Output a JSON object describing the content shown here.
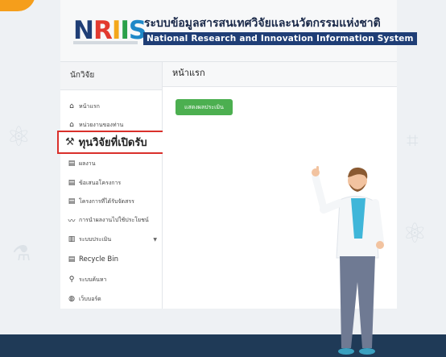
{
  "header": {
    "logo_text": "NRIIS",
    "thai_title": "ระบบข้อมูลสารสนเทศวิจัยและนวัตกรรมแห่งชาติ",
    "eng_title": "National Research and Innovation Information System"
  },
  "sidebar": {
    "heading": "นักวิจัย",
    "items": [
      {
        "label": "หน้าแรก",
        "icon": "home-icon"
      },
      {
        "label": "หน่วยงานของท่าน",
        "icon": "building-icon"
      },
      {
        "label": "ผลงาน",
        "icon": "clipboard-icon"
      },
      {
        "label": "ข้อเสนอโครงการ",
        "icon": "clipboard-icon"
      },
      {
        "label": "โครงการที่ได้รับจัดสรร",
        "icon": "clipboard-icon"
      },
      {
        "label": "การนำผลงานไปใช้ประโยชน์",
        "icon": "chart-line-icon"
      },
      {
        "label": "ระบบประเมิน",
        "icon": "bar-chart-icon"
      },
      {
        "label": "Recycle Bin",
        "icon": "clipboard-icon"
      },
      {
        "label": "ระบบค้นหา",
        "icon": "search-icon"
      },
      {
        "label": "เว็บบอร์ด",
        "icon": "globe-icon"
      }
    ],
    "highlighted": {
      "label": "ทุนวิจัยที่เปิดรับ",
      "icon": "gavel-icon"
    }
  },
  "main": {
    "title": "หน้าแรก",
    "button_label": "แสดงผลประเมิน"
  },
  "colors": {
    "accent_red": "#d9302b",
    "button_green": "#4caf50",
    "title_bar_navy": "#1f3e76",
    "footer_navy": "#1f3a57"
  }
}
